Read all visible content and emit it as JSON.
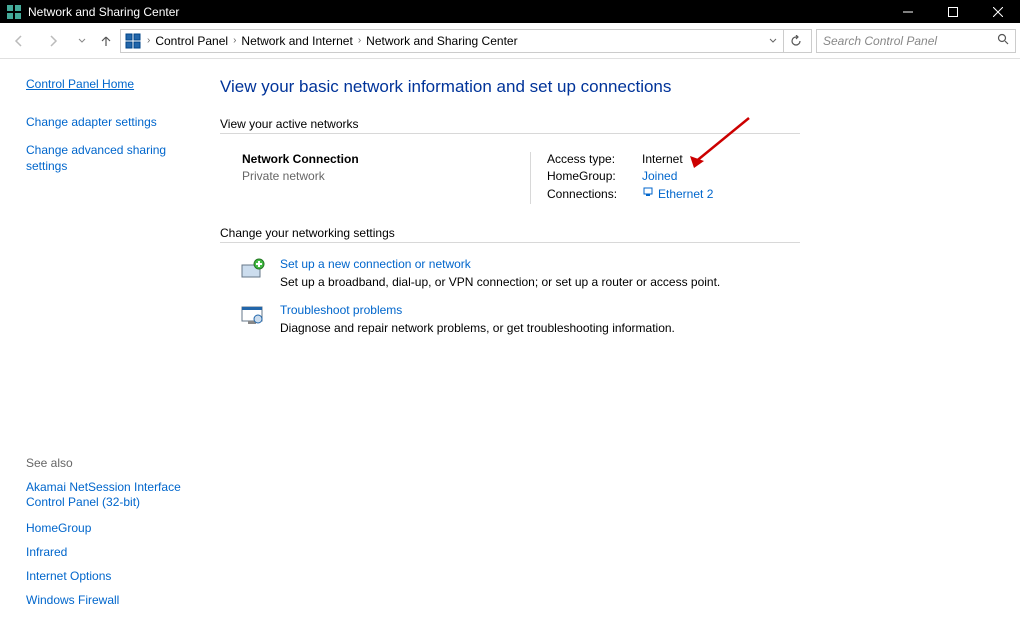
{
  "titlebar": {
    "title": "Network and Sharing Center"
  },
  "breadcrumb": {
    "seg1": "Control Panel",
    "seg2": "Network and Internet",
    "seg3": "Network and Sharing Center"
  },
  "search": {
    "placeholder": "Search Control Panel"
  },
  "sidebar": {
    "home": "Control Panel Home",
    "links": [
      "Change adapter settings",
      "Change advanced sharing settings"
    ],
    "see_also_header": "See also",
    "see_also": [
      "Akamai NetSession Interface Control Panel (32-bit)",
      "HomeGroup",
      "Infrared",
      "Internet Options",
      "Windows Firewall"
    ]
  },
  "main": {
    "heading": "View your basic network information and set up connections",
    "active_header": "View your active networks",
    "network": {
      "name": "Network Connection",
      "type": "Private network",
      "access_label": "Access type:",
      "access_value": "Internet",
      "homegroup_label": "HomeGroup:",
      "homegroup_value": "Joined",
      "connections_label": "Connections:",
      "connections_value": "Ethernet 2"
    },
    "change_header": "Change your networking settings",
    "setup": {
      "link": "Set up a new connection or network",
      "desc": "Set up a broadband, dial-up, or VPN connection; or set up a router or access point."
    },
    "troubleshoot": {
      "link": "Troubleshoot problems",
      "desc": "Diagnose and repair network problems, or get troubleshooting information."
    }
  }
}
